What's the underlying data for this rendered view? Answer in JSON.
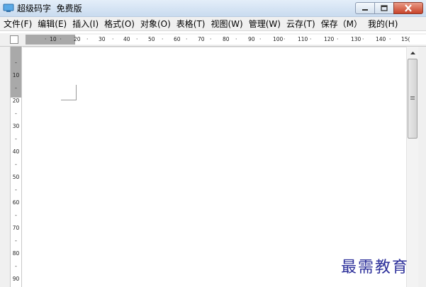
{
  "window": {
    "title": "超级码字  免费版",
    "minimize_label": "minimize",
    "maximize_label": "maximize",
    "close_label": "close"
  },
  "menu": {
    "items": [
      "文件(F)",
      "编辑(E)",
      "插入(I)",
      "格式(O)",
      "对象(O)",
      "表格(T)",
      "视图(W)",
      "管理(W)",
      "云存(T)",
      "保存（M）",
      "我的(H)"
    ]
  },
  "ruler": {
    "horizontal_ticks": [
      "·  10  ·",
      "20",
      "·",
      "30",
      "·",
      "40",
      "·",
      "50",
      "·",
      "60",
      "·",
      "70",
      "·",
      "80",
      "·",
      "90",
      "·",
      "100",
      "·",
      "110",
      "·",
      "120",
      "·",
      "130",
      "·",
      "140",
      "·",
      "15("
    ],
    "vertical_ticks": [
      "-",
      "10",
      "-",
      "20",
      "-",
      "30",
      "-",
      "40",
      "-",
      "50",
      "-",
      "60",
      "-",
      "70",
      "-",
      "80",
      "-",
      "90"
    ]
  },
  "watermark": "最需教育",
  "colors": {
    "title_gradient_top": "#e4eef9",
    "close_button": "#c8432a",
    "watermark": "#2c2f9a"
  }
}
